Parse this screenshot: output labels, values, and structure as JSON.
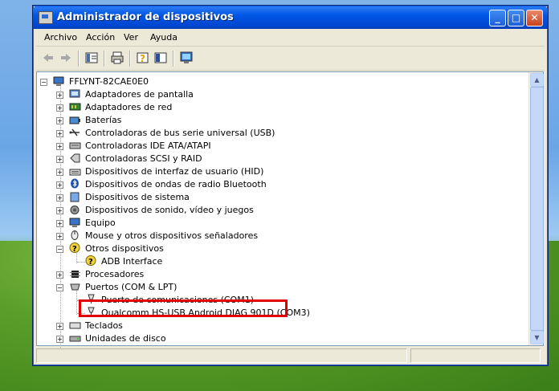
{
  "window": {
    "title": "Administrador de dispositivos",
    "title_icon": "device-manager-icon"
  },
  "titlebar_buttons": [
    {
      "name": "minimize-button",
      "glyph": "_"
    },
    {
      "name": "maximize-button",
      "glyph": "□"
    },
    {
      "name": "close-button",
      "glyph": "✕"
    }
  ],
  "menu": [
    "Archivo",
    "Acción",
    "Ver",
    "Ayuda"
  ],
  "toolbar_icons": [
    "back-arrow-icon",
    "forward-arrow-icon",
    "properties-icon",
    "print-icon",
    "help-icon",
    "pane-icon",
    "scan-hardware-icon"
  ],
  "tree": {
    "root": "FFLYNT-82CAE0E0",
    "items": [
      {
        "label": "Adaptadores de pantalla",
        "icon": "display-adapter-icon",
        "expanded": false
      },
      {
        "label": "Adaptadores de red",
        "icon": "network-adapter-icon",
        "expanded": false
      },
      {
        "label": "Baterías",
        "icon": "battery-icon",
        "expanded": false
      },
      {
        "label": "Controladoras de bus serie universal (USB)",
        "icon": "usb-icon",
        "expanded": false
      },
      {
        "label": "Controladoras IDE ATA/ATAPI",
        "icon": "ide-controller-icon",
        "expanded": false
      },
      {
        "label": "Controladoras SCSI y RAID",
        "icon": "scsi-icon",
        "expanded": false
      },
      {
        "label": "Dispositivos de interfaz de usuario (HID)",
        "icon": "hid-icon",
        "expanded": false
      },
      {
        "label": "Dispositivos de ondas de radio Bluetooth",
        "icon": "bluetooth-icon",
        "expanded": false
      },
      {
        "label": "Dispositivos de sistema",
        "icon": "system-device-icon",
        "expanded": false
      },
      {
        "label": "Dispositivos de sonido, vídeo y juegos",
        "icon": "sound-icon",
        "expanded": false
      },
      {
        "label": "Equipo",
        "icon": "computer-icon",
        "expanded": false
      },
      {
        "label": "Mouse y otros dispositivos señaladores",
        "icon": "mouse-icon",
        "expanded": false
      },
      {
        "label": "Otros dispositivos",
        "icon": "unknown-device-icon",
        "expanded": true,
        "children": [
          {
            "label": "ADB Interface",
            "icon": "unknown-device-icon"
          }
        ]
      },
      {
        "label": "Procesadores",
        "icon": "processor-icon",
        "expanded": false
      },
      {
        "label": "Puertos (COM & LPT)",
        "icon": "port-icon",
        "expanded": true,
        "children": [
          {
            "label": "Puerto de comunicaciones (COM1)",
            "icon": "port-connector-icon"
          },
          {
            "label": "Qualcomm HS-USB Android DIAG 901D (COM3)",
            "icon": "port-connector-icon",
            "highlighted": true
          }
        ]
      },
      {
        "label": "Teclados",
        "icon": "keyboard-icon",
        "expanded": false
      },
      {
        "label": "Unidades de disco",
        "icon": "disk-drive-icon",
        "expanded": false
      }
    ]
  },
  "colors": {
    "titlebar": "#0058e6",
    "highlight_box": "#e00000",
    "window_bg": "#ece9d8"
  }
}
